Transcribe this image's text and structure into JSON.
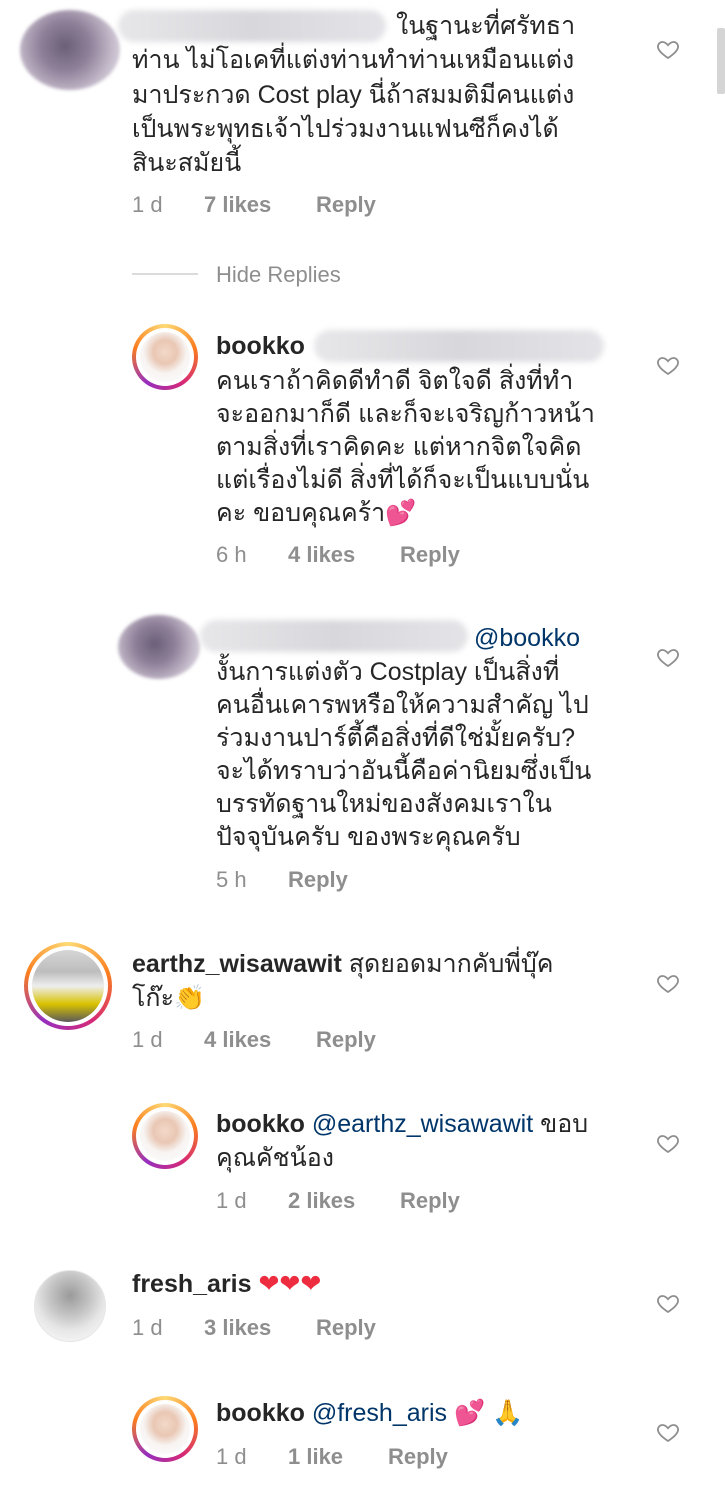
{
  "colors": {
    "text": "#262626",
    "meta": "#8e8e8e",
    "mention": "#003569",
    "divider": "#dbdbdb",
    "heart_red": "#ed2d3f"
  },
  "comments": [
    {
      "lines": [
        "ในฐานะที่ศรัทธา",
        "ท่าน ไม่โอเคที่แต่งท่านทำท่านเหมือนแต่ง",
        "มาประกวด Cost play นี่ถ้าสมมติมีคนแต่ง",
        "เป็นพระพุทธเจ้าไปร่วมงานแฟนซีก็คงได้",
        "สินะสมัยนี้"
      ],
      "time": "1 d",
      "likes": "7 likes",
      "reply": "Reply"
    },
    {
      "hide_replies": "Hide Replies"
    },
    {
      "username": "bookko",
      "lines": [
        "คนเราถ้าคิดดีทำดี จิตใจดี สิ่งที่ทำ",
        "จะออกมาก็ดี และก็จะเจริญก้าวหน้า",
        "ตามสิ่งที่เราคิดคะ แต่หากจิตใจคิด",
        "แต่เรื่องไม่ดี สิ่งที่ได้ก็จะเป็นแบบนั่น",
        "คะ ขอบคุณคร้า"
      ],
      "emoji": "💕",
      "time": "6 h",
      "likes": "4 likes",
      "reply": "Reply"
    },
    {
      "mention": "@bookko",
      "lines": [
        "งั้นการแต่งตัว Costplay เป็นสิ่งที่",
        "คนอื่นเคารพหรือให้ความสำคัญ ไป",
        "ร่วมงานปาร์ตี้คือสิ่งที่ดีใช่มั้ยครับ?",
        "จะได้ทราบว่าอันนี้คือค่านิยมซึ่งเป็น",
        "บรรทัดฐานใหม่ของสังคมเราใน",
        "ปัจจุบันครับ ของพระคุณครับ"
      ],
      "time": "5 h",
      "reply": "Reply"
    },
    {
      "username": "earthz_wisawawit",
      "lines": [
        "สุดยอดมากคับพี่บุ๊ค",
        "โก๊ะ"
      ],
      "emoji": "👏",
      "time": "1 d",
      "likes": "4 likes",
      "reply": "Reply"
    },
    {
      "username": "bookko",
      "mention": "@earthz_wisawawit",
      "lines": [
        "ขอบ",
        "คุณคัชน้อง"
      ],
      "time": "1 d",
      "likes": "2 likes",
      "reply": "Reply"
    },
    {
      "username": "fresh_aris",
      "hearts": "❤❤❤",
      "time": "1 d",
      "likes": "3 likes",
      "reply": "Reply"
    },
    {
      "username": "bookko",
      "mention": "@fresh_aris",
      "emoji": "💕 🙏",
      "time": "1 d",
      "likes": "1 like",
      "reply": "Reply"
    }
  ]
}
